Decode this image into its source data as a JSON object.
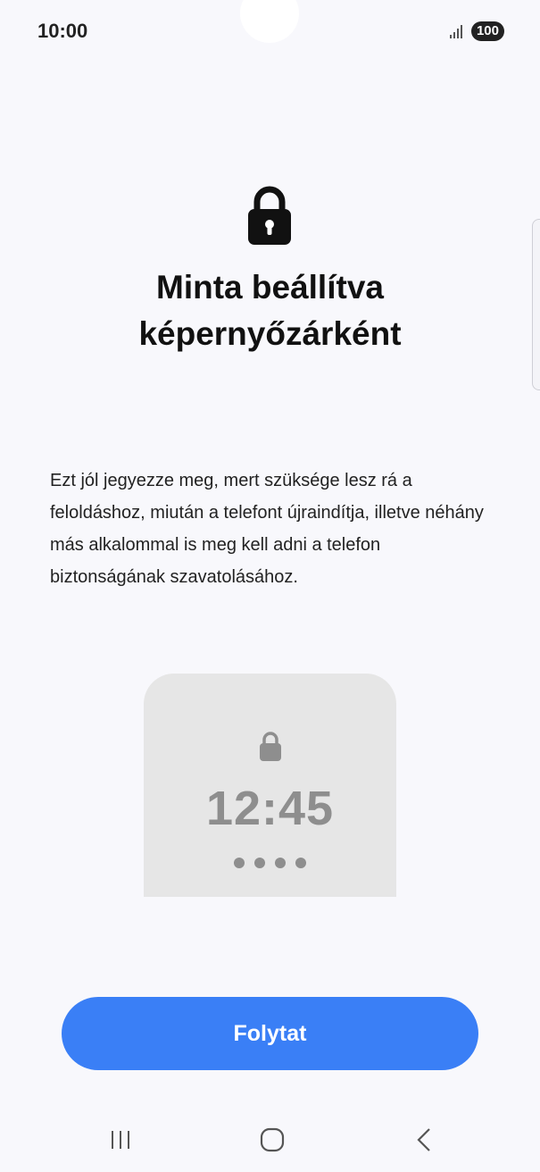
{
  "status_bar": {
    "time": "10:00",
    "battery": "100",
    "icons": [
      "signal-icon"
    ]
  },
  "header": {
    "icon": "lock-icon",
    "title": "Minta beállítva\nképernyőzárként"
  },
  "description": "Ezt jól jegyezze meg, mert szüksége lesz rá a feloldáshoz, miután a telefont újraindítja, illetve néhány más alkalommal is meg kell adni a telefon biztonságának szavatolásához.",
  "preview": {
    "icon": "lock-icon",
    "time": "12:45",
    "dot_count": 4
  },
  "actions": {
    "continue_label": "Folytat",
    "accent_color": "#3a7ff6"
  },
  "nav_bar": {
    "items": [
      "recents-icon",
      "home-icon",
      "back-icon"
    ]
  }
}
